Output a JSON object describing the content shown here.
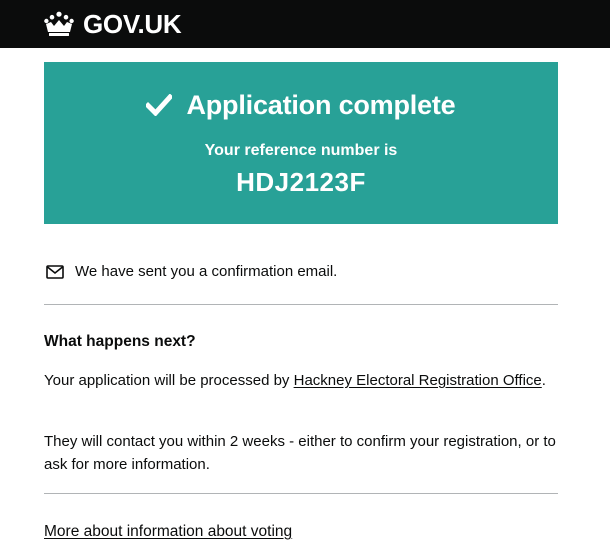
{
  "header": {
    "logo_text": "GOV.UK",
    "logo_icon": "crown-icon",
    "background_color": "#0b0c0c"
  },
  "panel": {
    "title": "Application complete",
    "title_icon": "tick-icon",
    "reference_label": "Your reference number is",
    "reference_number": "HDJ2123F",
    "background_color": "#28a197"
  },
  "confirmation": {
    "icon": "mail-icon",
    "text": "We have sent you a confirmation email."
  },
  "next_steps": {
    "heading": "What happens next?",
    "paragraph_1_before_link": "Your application will be processed by ",
    "paragraph_1_link": "Hackney Electoral Registration Office",
    "paragraph_1_after_link": ".",
    "paragraph_2": "They will contact you within 2 weeks - either to confirm your registration, or to ask for more information."
  },
  "footer_link": {
    "label": "More about information about voting"
  }
}
